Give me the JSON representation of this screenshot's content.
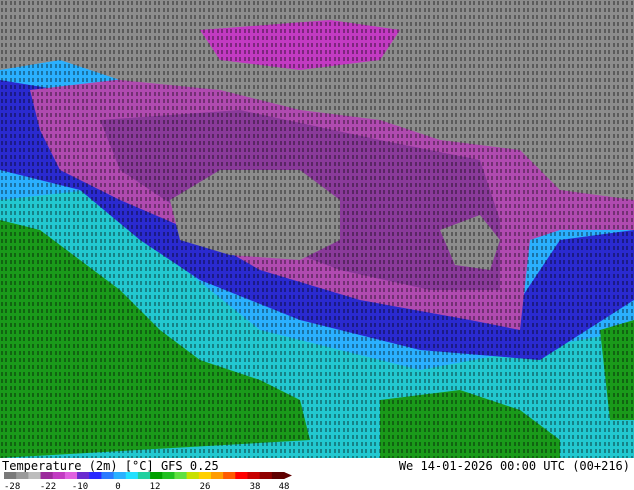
{
  "footer": {
    "title": "Temperature (2m) [°C] GFS 0.25",
    "datetime": "We 14-01-2026 00:00 UTC (00+216)"
  },
  "legend": {
    "colors": [
      "#7a7a7a",
      "#9a9a9a",
      "#bdbdbd",
      "#9c2a9c",
      "#c23ac2",
      "#e060e0",
      "#6a2ad0",
      "#2a2aff",
      "#2a7aff",
      "#2ab0ff",
      "#22e0ff",
      "#22d0a0",
      "#00a000",
      "#20c020",
      "#60e040",
      "#c8e000",
      "#ffd000",
      "#ff9c00",
      "#ff5a00",
      "#ff0000",
      "#c80000",
      "#900000",
      "#600000"
    ],
    "ticks": [
      "-28",
      "-22",
      "-10",
      "0",
      "12",
      "26",
      "38",
      "48"
    ]
  },
  "map_colors": {
    "ice": "#8c8c8c",
    "deep_cold": "#7a3a8a",
    "cold": "#b04ab0",
    "cool": "#2a2ad0",
    "mild": "#2ab0ff",
    "warm": "#22c8c0",
    "land_green": "#1a9a1a"
  }
}
